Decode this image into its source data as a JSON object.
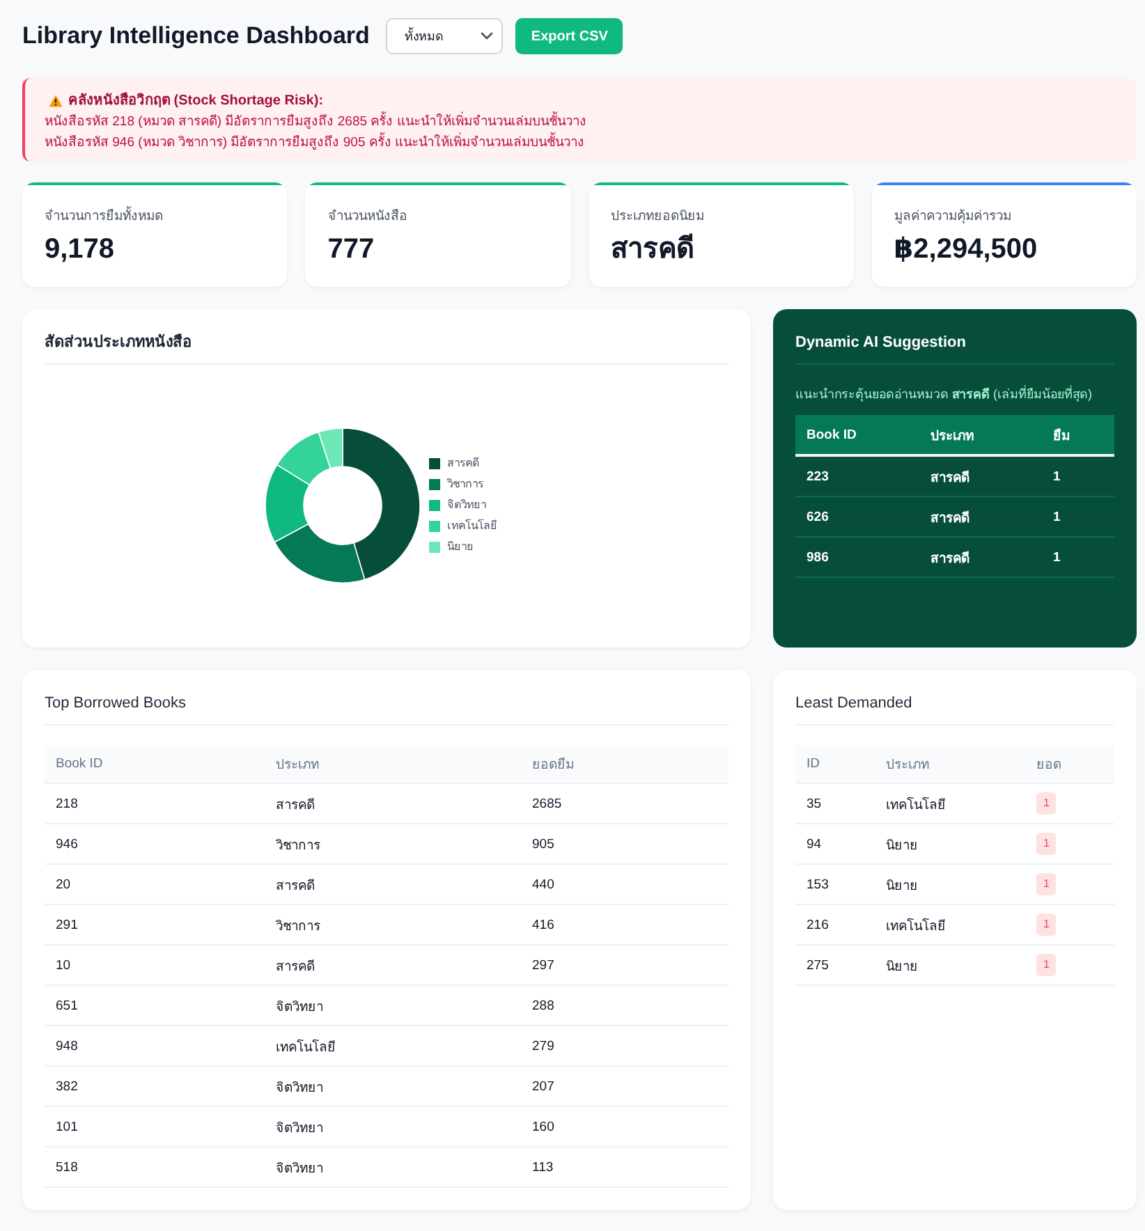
{
  "header": {
    "title": "Library Intelligence Dashboard",
    "category_select": {
      "value": "ทั้งหมด"
    },
    "export_button": "Export CSV"
  },
  "alert": {
    "title": "คลังหนังสือวิกฤต (Stock Shortage Risk):",
    "messages": [
      "หนังสือรหัส 218 (หมวด สารคดี) มีอัตราการยืมสูงถึง 2685 ครั้ง แนะนำให้เพิ่มจำนวนเล่มบนชั้นวาง",
      "หนังสือรหัส 946 (หมวด วิชาการ) มีอัตราการยืมสูงถึง 905 ครั้ง แนะนำให้เพิ่มจำนวนเล่มบนชั้นวาง"
    ]
  },
  "stats": [
    {
      "label": "จำนวนการยืมทั้งหมด",
      "value": "9,178",
      "color": "#10b981"
    },
    {
      "label": "จำนวนหนังสือ",
      "value": "777",
      "color": "#10b981"
    },
    {
      "label": "ประเภทยอดนิยม",
      "value": "สารคดี",
      "color": "#10b981"
    },
    {
      "label": "มูลค่าความคุ้มค่ารวม",
      "value": "฿2,294,500",
      "color": "#3b82f6"
    }
  ],
  "category_chart": {
    "title": "สัดส่วนประเภทหนังสือ",
    "legend": [
      {
        "label": "สารคดี",
        "color": "#064e3b"
      },
      {
        "label": "วิชาการ",
        "color": "#047857"
      },
      {
        "label": "จิตวิทยา",
        "color": "#10b981"
      },
      {
        "label": "เทคโนโลยี",
        "color": "#34d399"
      },
      {
        "label": "นิยาย",
        "color": "#6ee7b7"
      }
    ]
  },
  "ai_suggestion": {
    "title": "Dynamic AI Suggestion",
    "subtitle": "แนะนำกระตุ้นยอดอ่านหมวด **สารคดี** (เล่มที่ยืมน้อยที่สุด)",
    "columns": [
      "Book ID",
      "ประเภท",
      "ยืม"
    ],
    "rows": [
      [
        "223",
        "สารคดี",
        "1"
      ],
      [
        "626",
        "สารคดี",
        "1"
      ],
      [
        "986",
        "สารคดี",
        "1"
      ]
    ]
  },
  "top_borrowed": {
    "title": "Top Borrowed Books",
    "columns": [
      "Book ID",
      "ประเภท",
      "ยอดยืม"
    ],
    "rows": [
      [
        "218",
        "สารคดี",
        "2685"
      ],
      [
        "946",
        "วิชาการ",
        "905"
      ],
      [
        "20",
        "สารคดี",
        "440"
      ],
      [
        "291",
        "วิชาการ",
        "416"
      ],
      [
        "10",
        "สารคดี",
        "297"
      ],
      [
        "651",
        "จิตวิทยา",
        "288"
      ],
      [
        "948",
        "เทคโนโลยี",
        "279"
      ],
      [
        "382",
        "จิตวิทยา",
        "207"
      ],
      [
        "101",
        "จิตวิทยา",
        "160"
      ],
      [
        "518",
        "จิตวิทยา",
        "113"
      ]
    ]
  },
  "least_demanded": {
    "title": "Least Demanded",
    "columns": [
      "ID",
      "ประเภท",
      "ยอด"
    ],
    "rows": [
      [
        "35",
        "เทคโนโลยี",
        "1"
      ],
      [
        "94",
        "นิยาย",
        "1"
      ],
      [
        "153",
        "นิยาย",
        "1"
      ],
      [
        "216",
        "เทคโนโลยี",
        "1"
      ],
      [
        "275",
        "นิยาย",
        "1"
      ]
    ]
  }
}
